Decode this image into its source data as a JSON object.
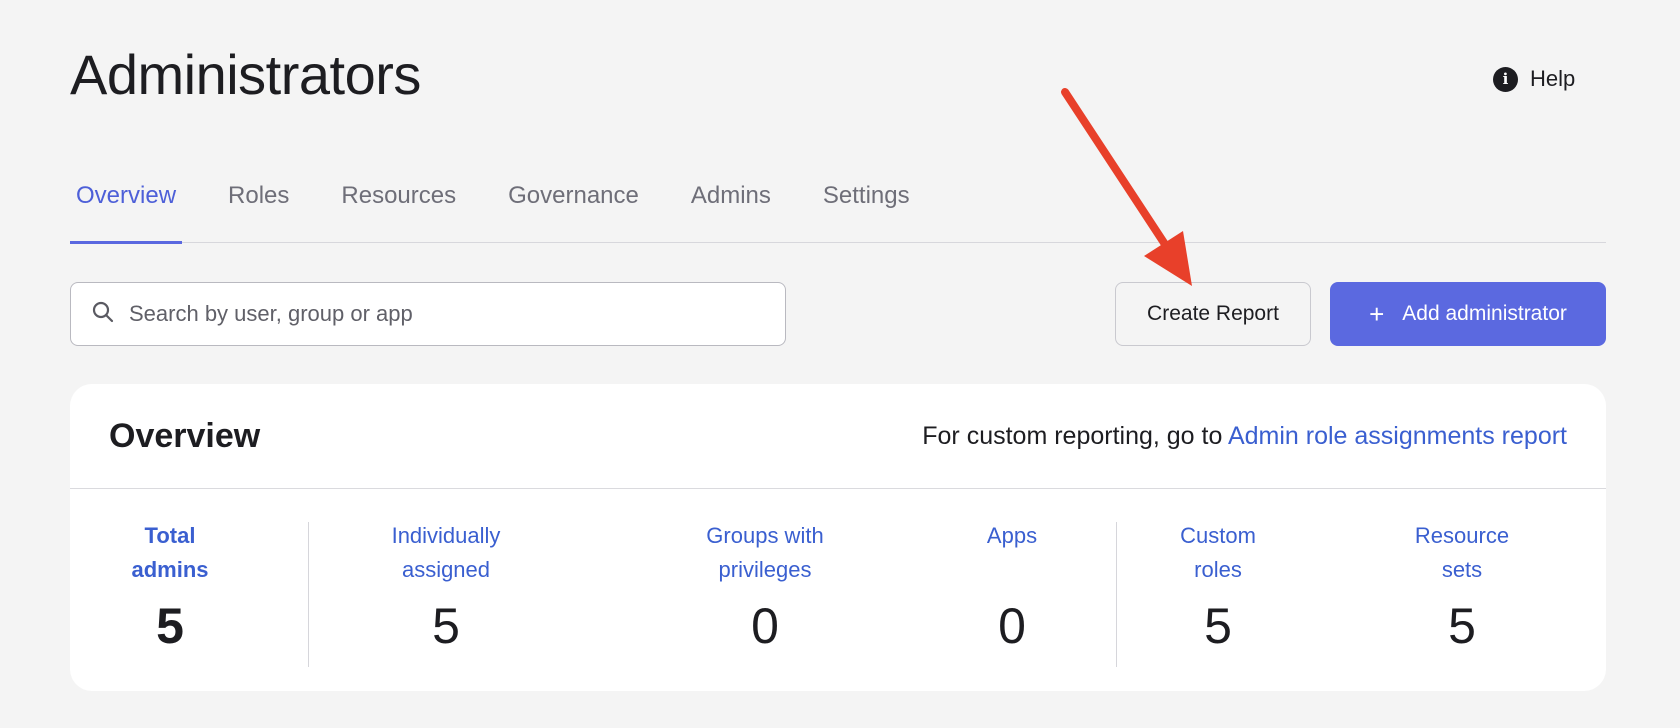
{
  "page": {
    "title": "Administrators",
    "help_label": "Help"
  },
  "tabs": [
    {
      "label": "Overview",
      "active": true
    },
    {
      "label": "Roles",
      "active": false
    },
    {
      "label": "Resources",
      "active": false
    },
    {
      "label": "Governance",
      "active": false
    },
    {
      "label": "Admins",
      "active": false
    },
    {
      "label": "Settings",
      "active": false
    }
  ],
  "toolbar": {
    "search_placeholder": "Search by user, group or app",
    "create_report_label": "Create Report",
    "add_admin_label": "Add administrator",
    "add_admin_icon": "plus-icon"
  },
  "overview": {
    "title": "Overview",
    "note_prefix": "For custom reporting, go to ",
    "note_link": "Admin role assignments report",
    "stats": [
      {
        "label_line1": "Total",
        "label_line2": "admins",
        "value": "5"
      },
      {
        "label_line1": "Individually",
        "label_line2": "assigned",
        "value": "5"
      },
      {
        "label_line1": "Groups with",
        "label_line2": "privileges",
        "value": "0"
      },
      {
        "label_line1": "Apps",
        "label_line2": "",
        "value": "0"
      },
      {
        "label_line1": "Custom",
        "label_line2": "roles",
        "value": "5"
      },
      {
        "label_line1": "Resource",
        "label_line2": "sets",
        "value": "5"
      }
    ]
  },
  "colors": {
    "accent": "#5b69e0",
    "link": "#3a5fd0",
    "annotation_arrow": "#e8402a",
    "background": "#f4f4f4"
  }
}
